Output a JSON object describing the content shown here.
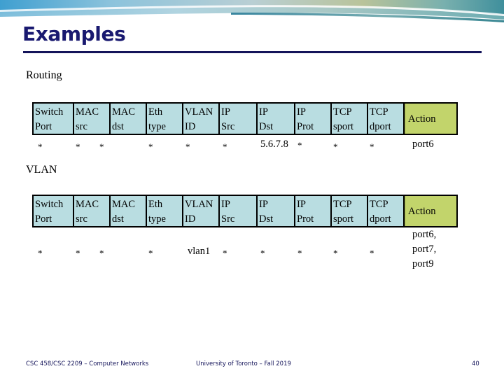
{
  "slide": {
    "title": "Examples",
    "page_number": "40",
    "accent_color": "#191970",
    "rule_color": "#14145a",
    "header_cell_color": "#b9dde1",
    "action_cell_color": "#c2d46b"
  },
  "sections": [
    {
      "caption": "Routing"
    },
    {
      "caption": "VLAN"
    }
  ],
  "columns": [
    "Switch\nPort",
    "MAC\nsrc",
    "MAC\ndst",
    "Eth\ntype",
    "VLAN\nID",
    "IP\nSrc",
    "IP\nDst",
    "IP\nProt",
    "TCP\nsport",
    "TCP\ndport",
    "Action"
  ],
  "tables": [
    {
      "name": "routing-flow-table",
      "row": [
        "*",
        "*",
        "*",
        "*",
        "*",
        "*",
        "5.6.7.8",
        "*",
        "*",
        "*",
        "port6"
      ]
    },
    {
      "name": "vlan-flow-table",
      "row": [
        "*",
        "*",
        "*",
        "*",
        "vlan1",
        "*",
        "*",
        "*",
        "*",
        "*",
        "port6,\nport7,\nport9"
      ]
    }
  ],
  "footer": {
    "left": "CSC 458/CSC 2209 – Computer Networks",
    "center": "University of Toronto – Fall 2019"
  }
}
